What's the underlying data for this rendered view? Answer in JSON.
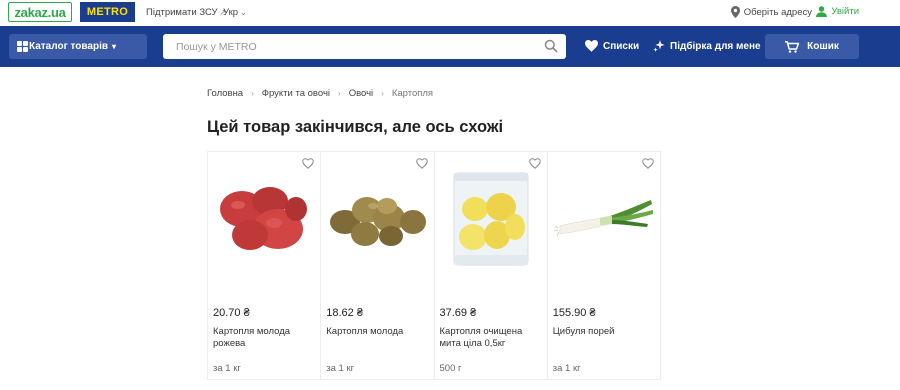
{
  "topbar": {
    "logo_zakaz": "zakaz.ua",
    "logo_metro": "METRO",
    "support_link": "Підтримати ЗСУ",
    "support_icon": "external-link-icon",
    "language": "Укр",
    "address": "Оберіть адресу",
    "login": "Увійти",
    "colors": {
      "brand_green": "#2ea94a",
      "metro_blue": "#1b3d8f",
      "metro_yellow": "#ffe100"
    }
  },
  "navbar": {
    "catalog_label": "Каталог товарів",
    "search_placeholder": "Пошук у METRO",
    "lists_label": "Списки",
    "picks_label": "Підбірка для мене",
    "cart_label": "Кошик",
    "colors": {
      "background": "#1b3d8f",
      "button": "#3a5aa8"
    }
  },
  "breadcrumb": [
    "Головна",
    "Фрукти та овочі",
    "Овочі",
    "Картопля"
  ],
  "page_title": "Цей товар закінчився, але ось схожі",
  "products": [
    {
      "price": "20.70 ₴",
      "name": "Картопля молода рожева",
      "unit": "за 1 кг",
      "image": "red-potatoes"
    },
    {
      "price": "18.62 ₴",
      "name": "Картопля молода",
      "unit": "за 1 кг",
      "image": "young-potatoes"
    },
    {
      "price": "37.69 ₴",
      "name": "Картопля очищена мита ціла 0,5кг",
      "unit": "500 г",
      "image": "peeled-potatoes-bag"
    },
    {
      "price": "155.90 ₴",
      "name": "Цибуля порей",
      "unit": "за 1 кг",
      "image": "leek"
    }
  ]
}
